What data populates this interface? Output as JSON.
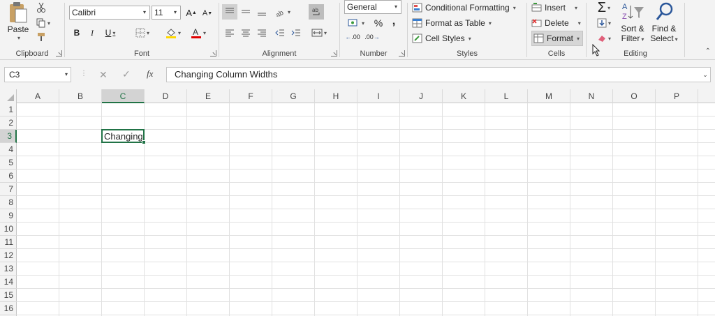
{
  "clipboard": {
    "paste": "Paste",
    "label": "Clipboard"
  },
  "font": {
    "name": "Calibri",
    "size": "11",
    "bold": "B",
    "italic": "I",
    "underline": "U",
    "grow": "A",
    "shrink": "A",
    "label": "Font"
  },
  "alignment": {
    "label": "Alignment"
  },
  "number": {
    "format": "General",
    "percent": "%",
    "comma": ",",
    "inc_decimal": ".00",
    "dec_decimal": ".00",
    "label": "Number"
  },
  "styles": {
    "conditional": "Conditional Formatting",
    "format_table": "Format as Table",
    "cell_styles": "Cell Styles",
    "label": "Styles"
  },
  "cells_group": {
    "insert": "Insert",
    "delete": "Delete",
    "format": "Format",
    "label": "Cells"
  },
  "editing": {
    "sum": "Σ",
    "sort_filter_1": "Sort &",
    "sort_filter_2": "Filter",
    "find_select_1": "Find &",
    "find_select_2": "Select",
    "label": "Editing"
  },
  "formula_bar": {
    "name_box": "C3",
    "cancel": "✕",
    "enter": "✓",
    "fx": "fx",
    "content": "Changing Column Widths"
  },
  "columns": [
    "A",
    "B",
    "C",
    "D",
    "E",
    "F",
    "G",
    "H",
    "I",
    "J",
    "K",
    "L",
    "M",
    "N",
    "O",
    "P"
  ],
  "rows": [
    "1",
    "2",
    "3",
    "4",
    "5",
    "6",
    "7",
    "8",
    "9",
    "10",
    "11",
    "12",
    "13",
    "14",
    "15",
    "16"
  ],
  "active_cell": {
    "ref": "C3",
    "display": "Changing"
  },
  "colors": {
    "accent": "#217346",
    "font_color": "#e00000",
    "highlight": "#ffd800"
  }
}
